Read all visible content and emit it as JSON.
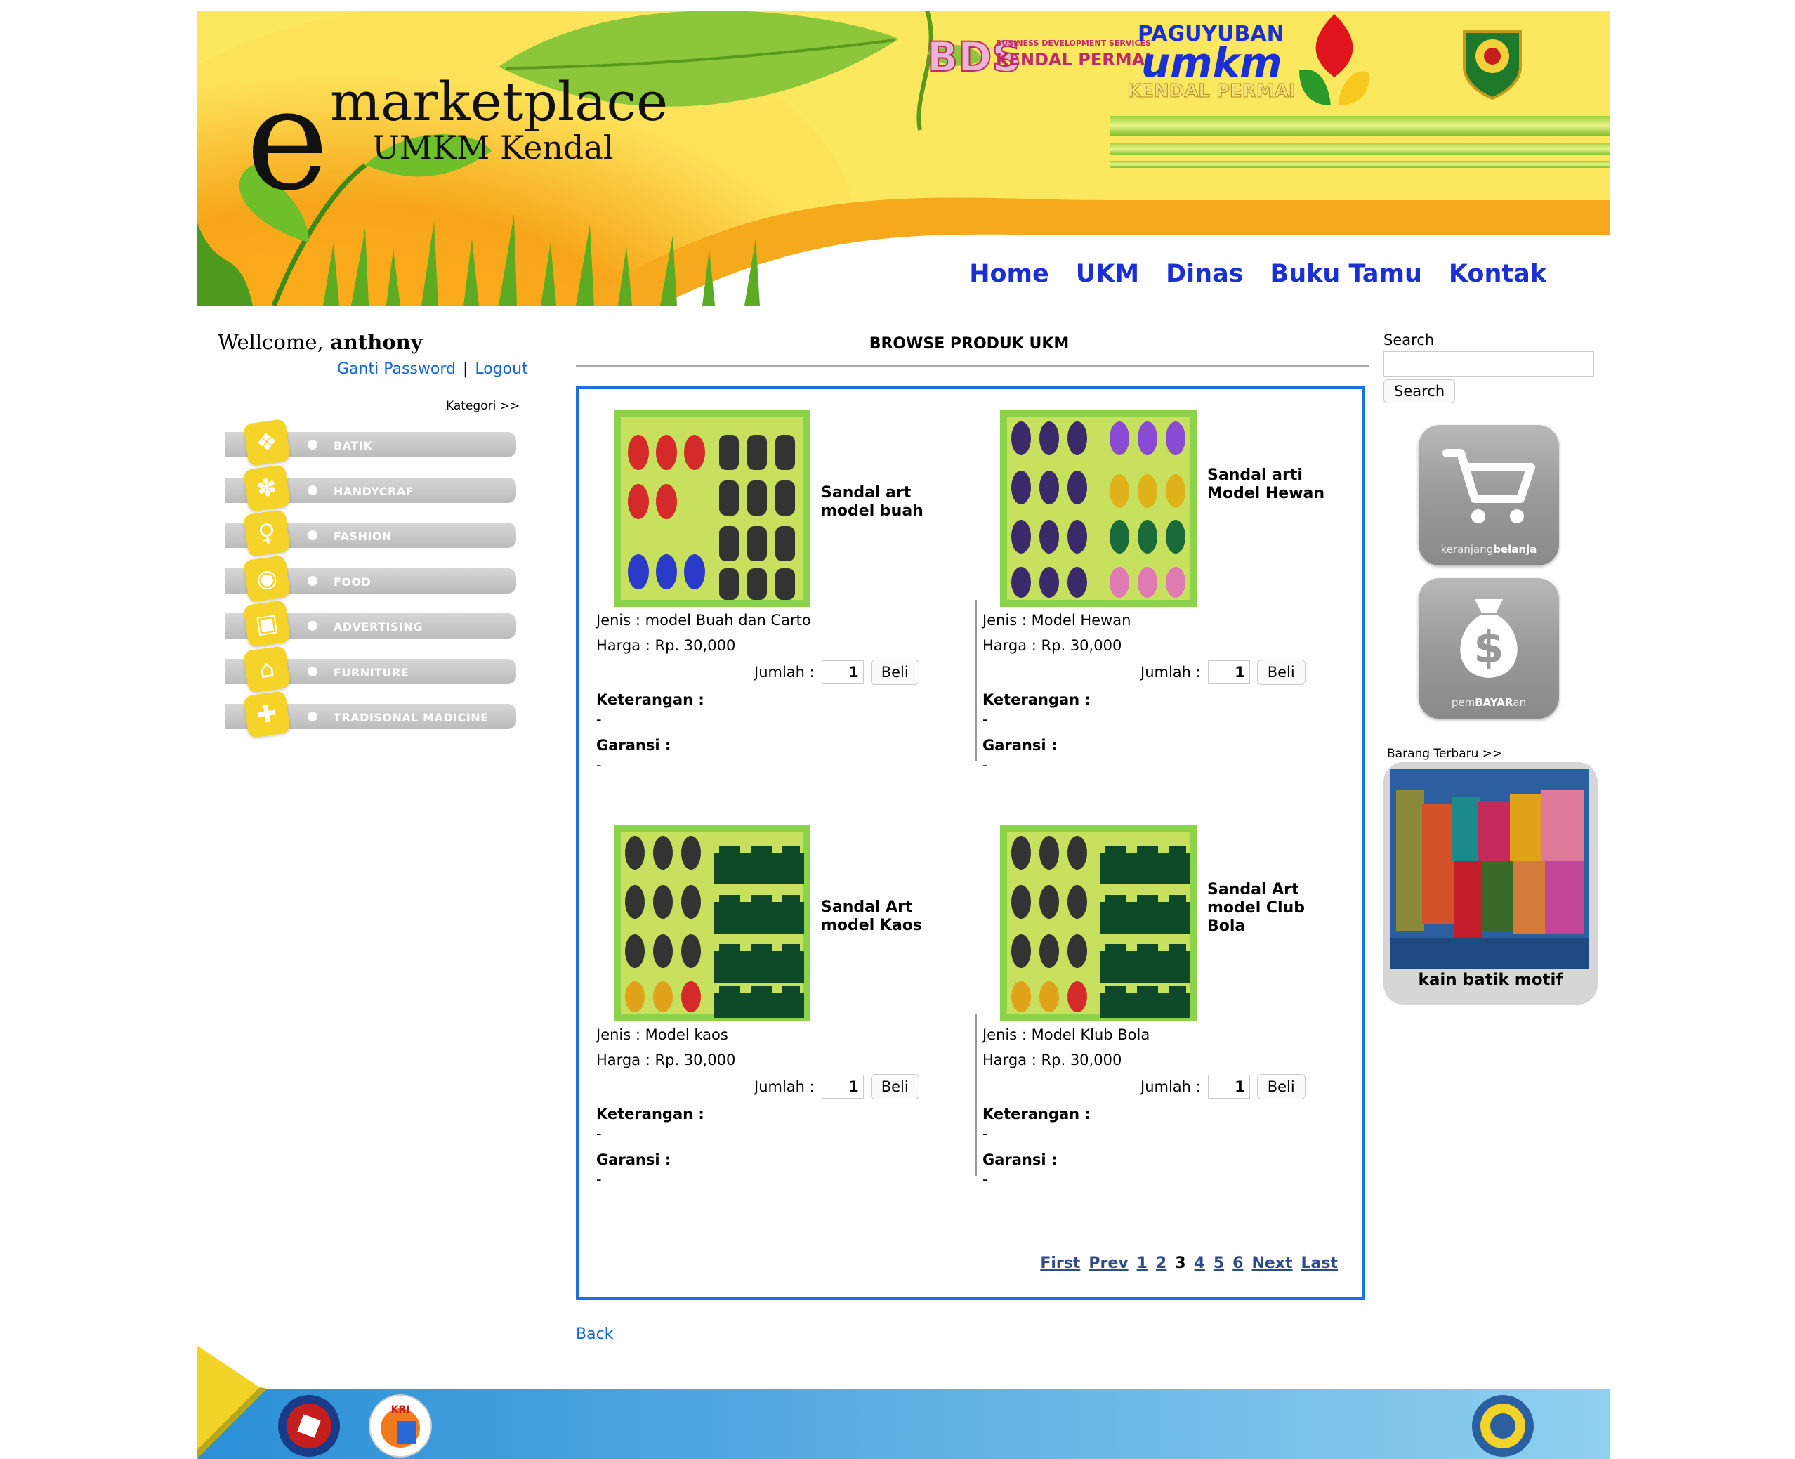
{
  "header": {
    "logo_e": "e",
    "logo_main": "marketplace",
    "logo_sub": "UMKM Kendal",
    "bds_text": "BDS",
    "bds_small": "BUSINESS DEVELOPMENT SERVICES",
    "bds_name": "KENDAL PERMAI",
    "paguyuban": "PAGUYUBAN",
    "umkm": "umkm",
    "umkm_sub": "KENDAL PERMAI"
  },
  "nav": [
    {
      "label": "Home"
    },
    {
      "label": "UKM"
    },
    {
      "label": "Dinas"
    },
    {
      "label": "Buku Tamu"
    },
    {
      "label": "Kontak"
    }
  ],
  "account": {
    "welcome_prefix": "Wellcome,",
    "username": "anthony",
    "change_password": "Ganti Password",
    "separator": "|",
    "logout": "Logout"
  },
  "categories": {
    "title": "Kategori >>",
    "items": [
      {
        "label": "BATIK",
        "icon": "batik-icon"
      },
      {
        "label": "HANDYCRAF",
        "icon": "handicraft-icon"
      },
      {
        "label": "FASHION",
        "icon": "fashion-icon"
      },
      {
        "label": "FOOD",
        "icon": "food-icon"
      },
      {
        "label": "ADVERTISING",
        "icon": "advertising-icon"
      },
      {
        "label": "FURNITURE",
        "icon": "furniture-icon"
      },
      {
        "label": "TRADISONAL MADICINE",
        "icon": "medicine-icon"
      }
    ]
  },
  "browse": {
    "title": "BROWSE PRODUK UKM",
    "jumlah_label": "Jumlah :",
    "beli_label": "Beli",
    "keterangan_label": "Keterangan :",
    "garansi_label": "Garansi :",
    "products": [
      {
        "name": "Sandal art model buah",
        "jenis": "Jenis : model Buah dan Carto",
        "harga": "Harga : Rp. 30,000",
        "qty": "1",
        "keterangan": "-",
        "garansi": "-"
      },
      {
        "name": "Sandal arti Model Hewan",
        "jenis": "Jenis : Model Hewan",
        "harga": "Harga : Rp. 30,000",
        "qty": "1",
        "keterangan": "-",
        "garansi": "-"
      },
      {
        "name": "Sandal Art model Kaos",
        "jenis": "Jenis : Model kaos",
        "harga": "Harga : Rp. 30,000",
        "qty": "1",
        "keterangan": "-",
        "garansi": "-"
      },
      {
        "name": "Sandal Art model Club Bola",
        "jenis": "Jenis : Model Klub Bola",
        "harga": "Harga : Rp. 30,000",
        "qty": "1",
        "keterangan": "-",
        "garansi": "-"
      }
    ],
    "pagination": {
      "first": "First",
      "prev": "Prev",
      "pages": [
        "1",
        "2",
        "3",
        "4",
        "5",
        "6"
      ],
      "current": "3",
      "next": "Next",
      "last": "Last"
    },
    "back": "Back"
  },
  "right": {
    "search_label": "Search",
    "search_value": "",
    "search_button": "Search",
    "cart_caption_a": "keranjang",
    "cart_caption_b": "belanja",
    "pay_caption_a": "pem",
    "pay_caption_b": "BAYAR",
    "pay_caption_c": "an",
    "barang_label": "Barang Terbaru >>",
    "barang_name": "kain batik motif"
  },
  "colors": {
    "nav": "#1a2fd4",
    "link": "#1565d8",
    "box_border": "#1f6fe0",
    "header_yellow": "#fbe75a",
    "footer_blue": "#2a8fd6"
  }
}
